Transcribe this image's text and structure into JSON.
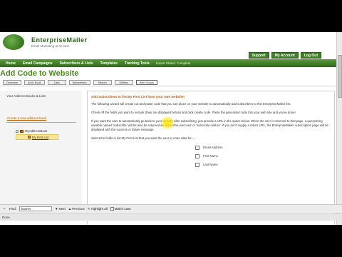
{
  "header": {
    "logo_text": "EnterpriseMailer",
    "logo_tagline": "Email Marketing at its best",
    "top_links": [
      "Support",
      "My Account",
      "Log Out"
    ]
  },
  "nav": {
    "items": [
      "Home",
      "Email Campaigns",
      "Subscribers & Lists",
      "Templates",
      "Tracking Tools"
    ],
    "status": "Import Status: Complete"
  },
  "page_title": "Add Code to Website",
  "tabs": [
    {
      "label": "Overview",
      "active": false
    },
    {
      "label": "Addr. Book",
      "active": false
    },
    {
      "label": "Lists",
      "active": false
    },
    {
      "label": "Subscribers",
      "active": false
    },
    {
      "label": "Search",
      "active": false
    },
    {
      "label": "Utilities",
      "active": false
    },
    {
      "label": "Web Scripts",
      "active": true
    }
  ],
  "left_panel": {
    "title": "Your Address Books & Lists",
    "create_link": "Create a new address book",
    "tree_root_label": "MyAddressBook",
    "tree_child_label": "My First List"
  },
  "content": {
    "title": "Add subscribers to list My First List from your own website!",
    "para1": "The following wizard will create cut-and-paste code that you can place on your website to automatically add subscribers to this EnterpriseMailer list.",
    "para2": "Check off the fields you want to include (they are displayed below) and click create code. Paste the generated code into your web site and you're done!",
    "para3": "If you want the user to automatically go back to your website after subscribing, just provide a URL in the space below. When the user is returned to that page, a querystring variable named 'subscribe' will be also be returned as 'subscribe=success' or 'subscribe=failure'. If you don't supply a return URL, the EnterpriseMailer subscription page will be displayed with the success or failure message.",
    "para4": "Select the fields in list My First List that you want the user to enter data for.....",
    "fields": [
      "Email Address",
      "First Name",
      "Last Name"
    ]
  },
  "findbar": {
    "close": "×",
    "find_label": "Find:",
    "find_value": "banner",
    "next_label": "Next",
    "prev_label": "Previous",
    "highlight_label": "Highlight all",
    "match_case_label": "Match case"
  },
  "status_text": "Done"
}
